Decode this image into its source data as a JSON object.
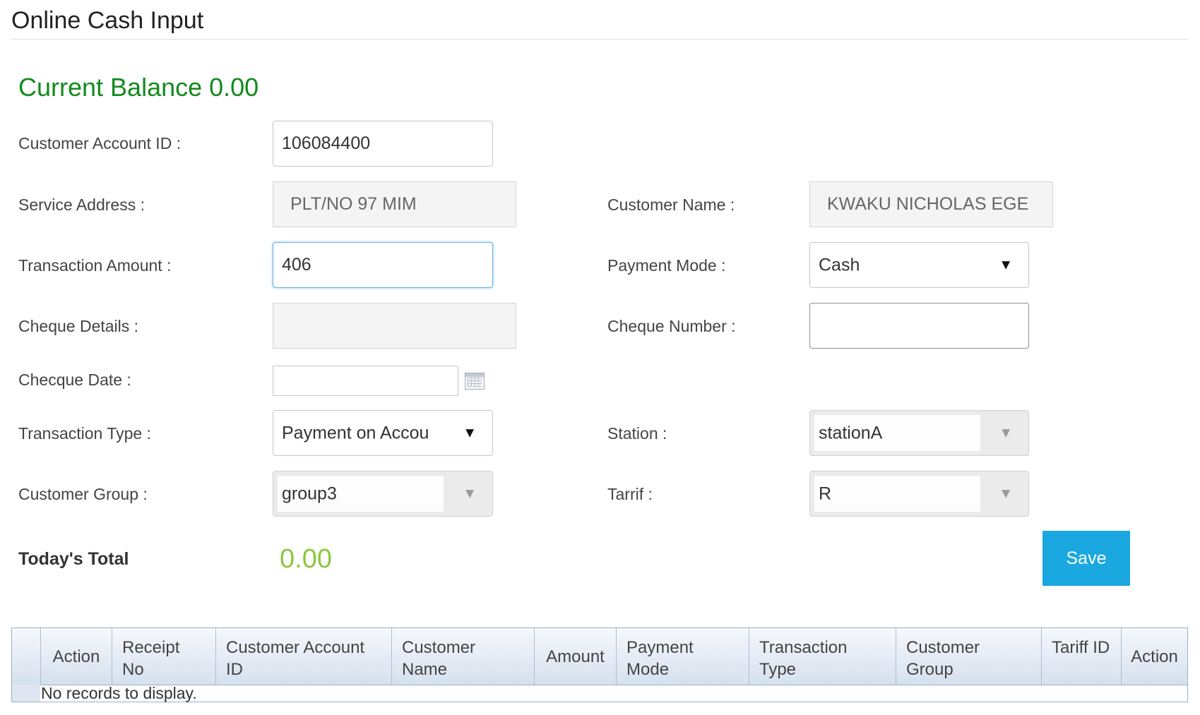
{
  "page": {
    "title": "Online Cash Input",
    "balance_text": "Current Balance 0.00"
  },
  "form": {
    "customer_account_id": {
      "label": "Customer Account ID :",
      "value": "106084400"
    },
    "service_address": {
      "label": "Service Address :",
      "value": "PLT/NO 97 MIM"
    },
    "customer_name": {
      "label": "Customer Name :",
      "value": "KWAKU NICHOLAS EGE"
    },
    "transaction_amount": {
      "label": "Transaction Amount :",
      "value": "406"
    },
    "payment_mode": {
      "label": "Payment Mode :",
      "value": "Cash"
    },
    "cheque_details": {
      "label": "Cheque Details :",
      "value": ""
    },
    "cheque_number": {
      "label": "Cheque Number :",
      "value": ""
    },
    "checque_date": {
      "label": "Checque Date :",
      "value": ""
    },
    "transaction_type": {
      "label": "Transaction Type :",
      "value": "Payment on Accou"
    },
    "station": {
      "label": "Station :",
      "value": "stationA"
    },
    "customer_group": {
      "label": "Customer Group :",
      "value": "group3"
    },
    "tarrif": {
      "label": "Tarrif :",
      "value": "R"
    }
  },
  "totals": {
    "label": "Today's Total",
    "value": "0.00"
  },
  "actions": {
    "save_label": "Save"
  },
  "grid": {
    "columns": [
      {
        "label": ""
      },
      {
        "label": "Action"
      },
      {
        "label": "Receipt No"
      },
      {
        "label": "Customer Account ID"
      },
      {
        "label": "Customer Name"
      },
      {
        "label": "Amount"
      },
      {
        "label": "Payment Mode"
      },
      {
        "label": "Transaction Type"
      },
      {
        "label": "Customer Group"
      },
      {
        "label": "Tariff ID"
      },
      {
        "label": "Action"
      }
    ],
    "empty_message": "No records to display."
  },
  "icons": {
    "calendar": "calendar-icon",
    "dropdown": "chevron-down-icon"
  },
  "colors": {
    "balance": "#138a1e",
    "today_total": "#8cc63f",
    "save_button": "#1ba8e0",
    "grid_header": "#d6e0ee"
  }
}
